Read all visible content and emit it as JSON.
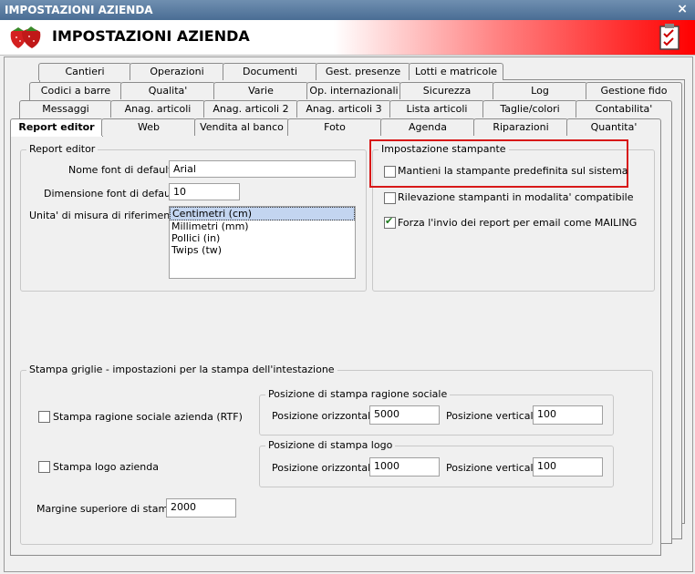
{
  "window": {
    "title": "IMPOSTAZIONI AZIENDA",
    "close_glyph": "×"
  },
  "banner": {
    "title": "IMPOSTAZIONI AZIENDA",
    "logo_icon": "strawberry-icon",
    "right_icon": "checklist-icon"
  },
  "tabs": {
    "row1": [
      "Cantieri",
      "Operazioni",
      "Documenti",
      "Gest. presenze",
      "Lotti e matricole"
    ],
    "row2": [
      "Codici a barre",
      "Qualita'",
      "Varie",
      "Op. internazionali",
      "Sicurezza",
      "Log",
      "Gestione fido"
    ],
    "row3": [
      "Messaggi",
      "Anag. articoli",
      "Anag. articoli 2",
      "Anag. articoli 3",
      "Lista articoli",
      "Taglie/colori",
      "Contabilita'"
    ],
    "row4": [
      "Report editor",
      "Web",
      "Vendita al banco",
      "Foto",
      "Agenda",
      "Riparazioni",
      "Quantita'"
    ],
    "active": "Report editor"
  },
  "report_editor": {
    "group_title": "Report editor",
    "font_label": "Nome font di default :",
    "font_value": "Arial",
    "size_label": "Dimensione font di default :",
    "size_value": "10",
    "unit_label": "Unita' di misura di riferimento :",
    "units": [
      "Centimetri (cm)",
      "Millimetri (mm)",
      "Pollici (in)",
      "Twips (tw)"
    ],
    "selected_unit": "Centimetri (cm)"
  },
  "printer": {
    "group_title": "Impostazione stampante",
    "opt1": "Mantieni la stampante predefinita sul sistema",
    "opt1_checked": false,
    "opt2": "Rilevazione stampanti in modalita' compatibile",
    "opt2_checked": false,
    "opt3": "Forza l'invio dei report per email come MAILING",
    "opt3_checked": true
  },
  "grid_print": {
    "group_title": "Stampa griglie - impostazioni per la stampa dell'intestazione",
    "company_name_label": "Stampa ragione sociale azienda (RTF)",
    "company_name_checked": false,
    "logo_label": "Stampa logo azienda",
    "logo_checked": false,
    "pos_name_title": "Posizione di stampa ragione sociale",
    "pos_logo_title": "Posizione di stampa logo",
    "horiz_label": "Posizione orizzontale",
    "vert_label": "Posizione verticale",
    "name_h": "5000",
    "name_v": "100",
    "logo_h": "1000",
    "logo_v": "100",
    "margin_label": "Margine superiore di stampa",
    "margin_value": "2000"
  },
  "colors": {
    "highlight_box": "#d81818",
    "title_bar": "#5a7ba0",
    "check": "#1e7a1e"
  }
}
